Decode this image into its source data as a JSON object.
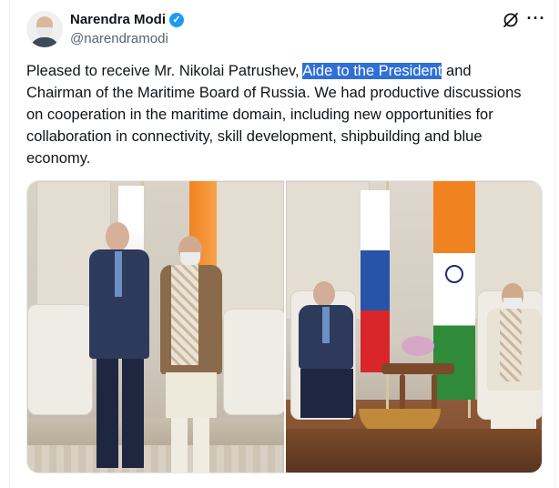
{
  "post": {
    "author_name": "Narendra Modi",
    "verified_glyph": "✓",
    "handle": "@narendramodi",
    "text_before": "Pleased to receive Mr. Nikolai Patrushev, ",
    "text_highlight": "Aide to the President",
    "text_after": " and Chairman of the Maritime Board of Russia. We had productive discussions on cooperation in the maritime domain, including new opportunities for collaboration in connectivity, skill development, shipbuilding and blue economy.",
    "more_glyph": "···"
  },
  "icons": {
    "avatar": "avatar",
    "verified": "verified-badge-icon",
    "grok": "grok-icon",
    "more": "more-options-icon"
  },
  "colors": {
    "text": "#0f1419",
    "secondary": "#536471",
    "verified": "#1d9bf0",
    "highlight": "#2f6fd6"
  },
  "media": {
    "count": 2
  }
}
